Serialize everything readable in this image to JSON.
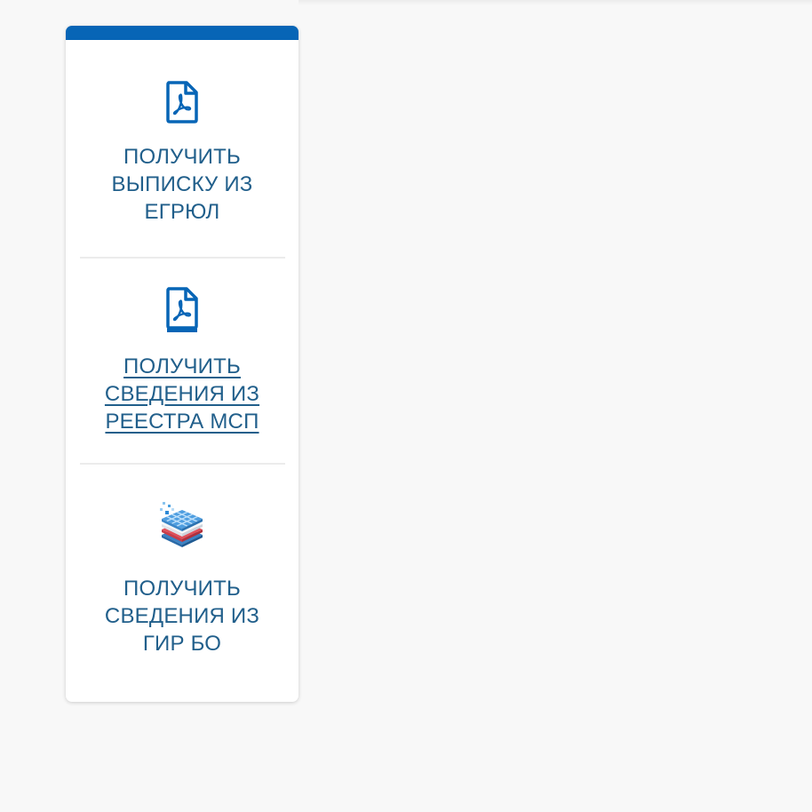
{
  "services": [
    {
      "label": "ПОЛУЧИТЬ ВЫПИСКУ ИЗ ЕГРЮЛ",
      "icon": "pdf-file-icon",
      "underlined": false
    },
    {
      "label": "ПОЛУЧИТЬ СВЕДЕНИЯ ИЗ РЕЕСТРА МСП",
      "icon": "pdf-file-icon",
      "underlined": true
    },
    {
      "label": "ПОЛУЧИТЬ СВЕДЕНИЯ ИЗ ГИР БО",
      "icon": "data-layers-icon",
      "underlined": false
    }
  ],
  "colors": {
    "accent": "#0765b6",
    "link_text": "#215f8b",
    "background": "#f8f8f8",
    "card": "#ffffff"
  }
}
